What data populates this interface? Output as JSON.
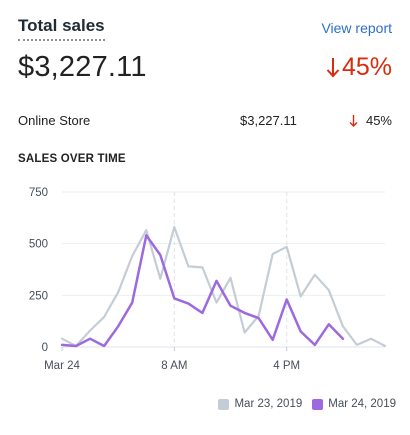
{
  "header": {
    "title": "Total sales",
    "view_report": "View report"
  },
  "summary": {
    "total": "$3,227.11",
    "change": "45%",
    "change_direction": "down",
    "change_color": "#d82c0d"
  },
  "breakdown": [
    {
      "label": "Online Store",
      "amount": "$3,227.11",
      "change": "45%",
      "direction": "down"
    }
  ],
  "section_title": "SALES OVER TIME",
  "chart_data": {
    "type": "line",
    "title": "SALES OVER TIME",
    "y_ticks": [
      "750",
      "500",
      "250",
      "0"
    ],
    "ylim": [
      0,
      750
    ],
    "x_ticks": [
      "Mar 24",
      "8 AM",
      "4 PM"
    ],
    "x": [
      0,
      1,
      2,
      3,
      4,
      5,
      6,
      7,
      8,
      9,
      10,
      11,
      12,
      13,
      14,
      15,
      16,
      17,
      18,
      19,
      20,
      21,
      22,
      23
    ],
    "grid": true,
    "legend_position": "bottom-right",
    "series": [
      {
        "name": "Mar 23, 2019",
        "color": "#c4cdd5",
        "values": [
          40,
          5,
          80,
          145,
          265,
          440,
          565,
          330,
          580,
          390,
          385,
          215,
          335,
          70,
          150,
          450,
          485,
          245,
          350,
          275,
          100,
          10,
          40,
          5
        ]
      },
      {
        "name": "Mar 24, 2019",
        "color": "#9c6ade",
        "values": [
          10,
          5,
          40,
          5,
          100,
          215,
          540,
          445,
          235,
          210,
          165,
          320,
          200,
          165,
          140,
          35,
          230,
          75,
          10,
          110,
          40
        ]
      }
    ]
  },
  "legend": [
    {
      "label": "Mar 23, 2019",
      "color": "#c4cdd5"
    },
    {
      "label": "Mar 24, 2019",
      "color": "#9c6ade"
    }
  ],
  "icons": {
    "change_arrow": "arrow-down-icon"
  }
}
